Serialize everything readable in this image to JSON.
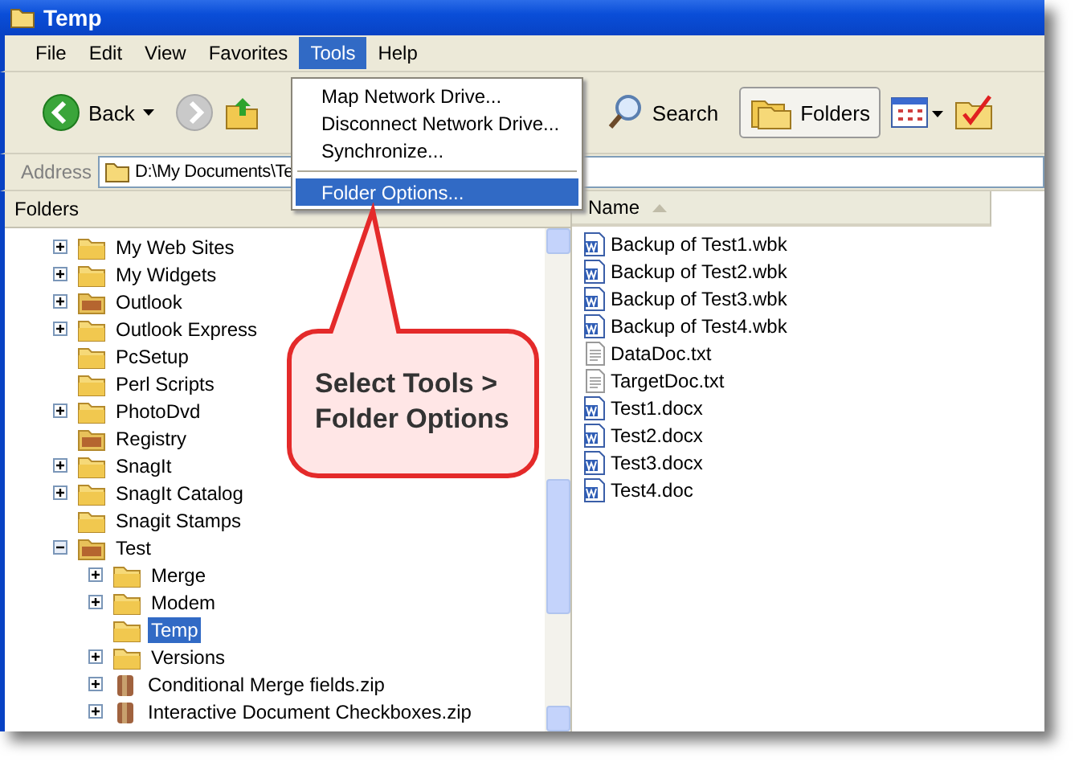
{
  "window": {
    "title": "Temp"
  },
  "menu_bar": [
    {
      "label": "File",
      "selected": false
    },
    {
      "label": "Edit",
      "selected": false
    },
    {
      "label": "View",
      "selected": false
    },
    {
      "label": "Favorites",
      "selected": false
    },
    {
      "label": "Tools",
      "selected": true
    },
    {
      "label": "Help",
      "selected": false
    }
  ],
  "tools_menu": [
    {
      "kind": "item",
      "label": "Map Network Drive...",
      "selected": false
    },
    {
      "kind": "item",
      "label": "Disconnect Network Drive...",
      "selected": false
    },
    {
      "kind": "item",
      "label": "Synchronize...",
      "selected": false
    },
    {
      "kind": "separator"
    },
    {
      "kind": "item",
      "label": "Folder Options...",
      "selected": true
    }
  ],
  "toolbar": {
    "back": "Back",
    "search": "Search",
    "folders": {
      "label": "Folders",
      "selected": true
    }
  },
  "address": {
    "label": "Address",
    "value": "D:\\My Documents\\Te"
  },
  "folders_pane": {
    "title": "Folders",
    "tree": [
      {
        "label": "My Web Sites",
        "kind": "folder",
        "expanded": false,
        "selected": false
      },
      {
        "label": "My Widgets",
        "kind": "folder",
        "expanded": false,
        "selected": false
      },
      {
        "label": "Outlook",
        "kind": "filled",
        "expanded": false,
        "selected": false
      },
      {
        "label": "Outlook Express",
        "kind": "folder",
        "expanded": false,
        "selected": false
      },
      {
        "label": "PcSetup",
        "kind": "folder",
        "selected": false
      },
      {
        "label": "Perl Scripts",
        "kind": "folder",
        "selected": false
      },
      {
        "label": "PhotoDvd",
        "kind": "folder",
        "expanded": false,
        "selected": false
      },
      {
        "label": "Registry",
        "kind": "filled",
        "selected": false
      },
      {
        "label": "SnagIt",
        "kind": "folder",
        "expanded": false,
        "selected": false
      },
      {
        "label": "SnagIt Catalog",
        "kind": "folder",
        "expanded": false,
        "selected": false
      },
      {
        "label": "Snagit Stamps",
        "kind": "folder",
        "selected": false
      },
      {
        "label": "Test",
        "kind": "filled",
        "expanded": true,
        "selected": false,
        "children": [
          {
            "label": "Merge",
            "kind": "folder",
            "expanded": false,
            "selected": false
          },
          {
            "label": "Modem",
            "kind": "folder",
            "expanded": false,
            "selected": false
          },
          {
            "label": "Temp",
            "kind": "folder",
            "selected": true
          },
          {
            "label": "Versions",
            "kind": "folder",
            "expanded": false,
            "selected": false
          },
          {
            "label": "Conditional Merge fields.zip",
            "kind": "zip",
            "expanded": false,
            "selected": false
          },
          {
            "label": "Interactive Document Checkboxes.zip",
            "kind": "zip",
            "expanded": false,
            "selected": false
          }
        ]
      }
    ]
  },
  "file_list": {
    "column": "Name",
    "files": [
      {
        "name": "Backup of Test1.wbk",
        "kind": "word"
      },
      {
        "name": "Backup of Test2.wbk",
        "kind": "word"
      },
      {
        "name": "Backup of Test3.wbk",
        "kind": "word"
      },
      {
        "name": "Backup of Test4.wbk",
        "kind": "word"
      },
      {
        "name": "DataDoc.txt",
        "kind": "text"
      },
      {
        "name": "TargetDoc.txt",
        "kind": "text"
      },
      {
        "name": "Test1.docx",
        "kind": "word"
      },
      {
        "name": "Test2.docx",
        "kind": "word"
      },
      {
        "name": "Test3.docx",
        "kind": "word"
      },
      {
        "name": "Test4.doc",
        "kind": "word"
      }
    ]
  },
  "callout": {
    "lines": [
      "Select Tools >",
      "Folder Options"
    ]
  }
}
